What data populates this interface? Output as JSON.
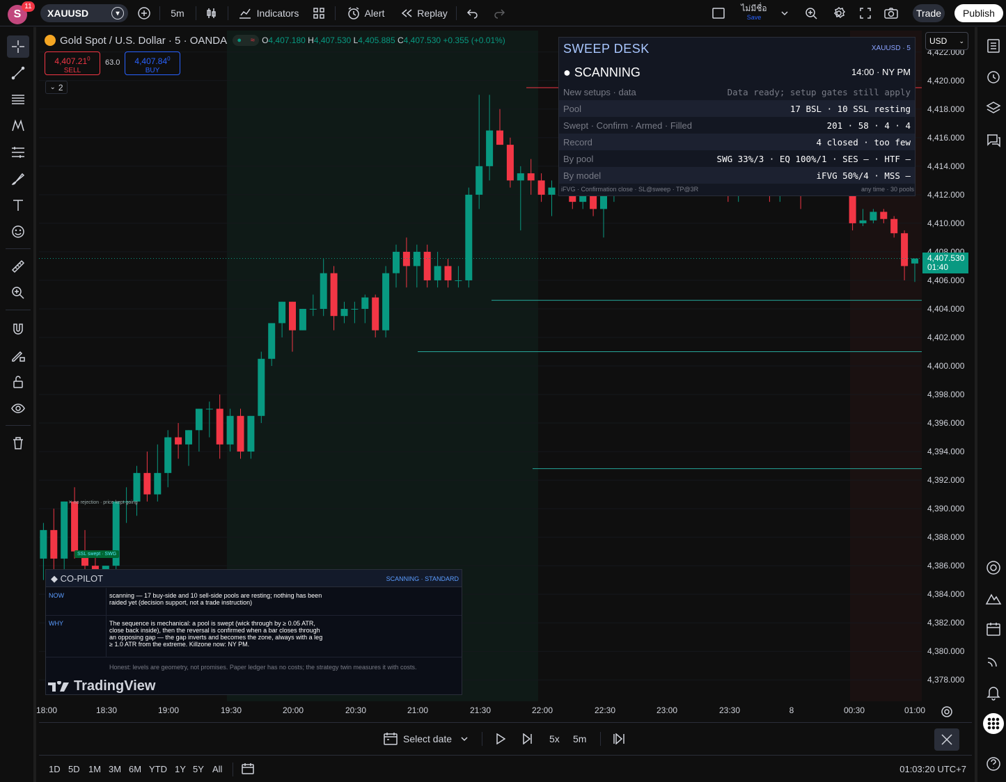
{
  "topbar": {
    "avatar_letter": "S",
    "notifications": "11",
    "symbol": "XAUUSD",
    "interval": "5m",
    "indicators_label": "Indicators",
    "alert_label": "Alert",
    "replay_label": "Replay",
    "layout_name": "ไม่มีชื่อ",
    "layout_save": "Save",
    "trade_label": "Trade",
    "publish_label": "Publish"
  },
  "legend": {
    "title": "Gold Spot / U.S. Dollar · 5 · OANDA",
    "o_key": "O",
    "o_val": "4,407.180",
    "h_key": "H",
    "h_val": "4,407.530",
    "l_key": "L",
    "l_val": "4,405.885",
    "c_key": "C",
    "c_val": "4,407.530",
    "change": "+0.355 (+0.01%)",
    "sell_price": "4,407.21",
    "sell_price_small": "0",
    "sell_label": "SELL",
    "spread": "63.0",
    "buy_price": "4,407.84",
    "buy_price_small": "0",
    "buy_label": "BUY",
    "collapsed_count": "2"
  },
  "currency": "USD",
  "price_axis": {
    "ticks": [
      "4,422.000",
      "4,420.000",
      "4,418.000",
      "4,416.000",
      "4,414.000",
      "4,412.000",
      "4,410.000",
      "4,408.000",
      "4,406.000",
      "4,404.000",
      "4,402.000",
      "4,400.000",
      "4,398.000",
      "4,396.000",
      "4,394.000",
      "4,392.000",
      "4,390.000",
      "4,388.000",
      "4,386.000",
      "4,384.000",
      "4,382.000",
      "4,380.000",
      "4,378.000"
    ],
    "current_price": "4,407.530",
    "countdown": "01:40"
  },
  "time_axis": [
    "18:00",
    "18:30",
    "19:00",
    "19:30",
    "20:00",
    "20:30",
    "21:00",
    "21:30",
    "22:00",
    "22:30",
    "23:00",
    "23:30",
    "8",
    "00:30",
    "01:00"
  ],
  "sweep_desk": {
    "title": "SWEEP DESK",
    "tag": "XAUUSD · 5",
    "state": "● SCANNING",
    "time": "14:00 · NY PM",
    "rows": [
      {
        "label": "New setups · data",
        "value": "Data ready; setup gates still apply"
      },
      {
        "label": "Pool",
        "value": "17 BSL · 10 SSL resting"
      },
      {
        "label": "Swept · Confirm · Armed · Filled",
        "value": "201 · 58 · 4 · 4"
      },
      {
        "label": "Record",
        "value": "4 closed · too few"
      },
      {
        "label": "By pool",
        "value": "SWG 33%/3 · EQ 100%/1 · SES — · HTF —"
      },
      {
        "label": "By model",
        "value": "iFVG 50%/4 · MSS —"
      }
    ],
    "footer_left": "iFVG · Confirmation close · SL@sweep · TP@3R",
    "footer_right": "any time · 30 pools"
  },
  "copilot": {
    "title": "◆ CO-PILOT",
    "status": "SCANNING · STANDARD",
    "now_key": "NOW",
    "now_text": "scanning — 17 buy-side and 10 sell-side pools are resting; nothing has been raided yet (decision support, not a trade instruction)",
    "why_key": "WHY",
    "why_text": "The sequence is mechanical: a pool is swept (wick through by ≥ 0.05 ATR, close back inside), then the reversal is confirmed when a bar closes through an opposing gap — the gap inverts and becomes the zone, always with a leg ≥ 1.0 ATR from the extreme. Killzone now: NY PM.",
    "honest_text": "Honest: levels are geometry, not promises. Paper ledger has no costs; the strategy twin measures it with costs.",
    "logo_text": "TradingView"
  },
  "annotations": {
    "no_rejection": "✕ no rejection · price kept going",
    "ssl_swept": "SSL swept · SWG"
  },
  "replay": {
    "select_date": "Select date",
    "speed": "5x",
    "interval": "5m"
  },
  "ranges": [
    "1D",
    "5D",
    "1M",
    "3M",
    "6M",
    "YTD",
    "1Y",
    "5Y",
    "All"
  ],
  "clock": "01:03:20 UTC+7",
  "colors": {
    "up": "#089981",
    "down": "#f23645",
    "accent": "#2962ff"
  },
  "chart_data": {
    "type": "candlestick",
    "symbol": "XAUUSD",
    "timeframe": "5",
    "ylim": [
      4376.5,
      4423.5
    ],
    "candles": [
      {
        "o": 4390.5,
        "h": 4392.5,
        "l": 4388.0,
        "c": 4390.0
      },
      {
        "o": 4390.0,
        "h": 4391.5,
        "l": 4388.5,
        "c": 4389.5
      },
      {
        "o": 4389.5,
        "h": 4394.5,
        "l": 4387.0,
        "c": 4392.0
      },
      {
        "o": 4392.0,
        "h": 4394.5,
        "l": 4389.5,
        "c": 4394.0
      },
      {
        "o": 4394.0,
        "h": 4395.0,
        "l": 4391.0,
        "c": 4392.5
      },
      {
        "o": 4392.5,
        "h": 4393.0,
        "l": 4389.0,
        "c": 4389.5
      },
      {
        "o": 4389.5,
        "h": 4390.0,
        "l": 4388.0,
        "c": 4389.0
      },
      {
        "o": 4389.0,
        "h": 4390.0,
        "l": 4385.5,
        "c": 4386.5
      },
      {
        "o": 4386.5,
        "h": 4389.0,
        "l": 4385.0,
        "c": 4388.5
      },
      {
        "o": 4388.5,
        "h": 4390.0,
        "l": 4383.5,
        "c": 4386.5
      },
      {
        "o": 4386.5,
        "h": 4390.5,
        "l": 4385.5,
        "c": 4390.5
      },
      {
        "o": 4390.5,
        "h": 4391.5,
        "l": 4386.5,
        "c": 4387.0
      },
      {
        "o": 4387.0,
        "h": 4388.5,
        "l": 4384.0,
        "c": 4386.0
      },
      {
        "o": 4386.0,
        "h": 4387.0,
        "l": 4382.0,
        "c": 4382.5
      },
      {
        "o": 4382.5,
        "h": 4386.0,
        "l": 4381.5,
        "c": 4386.0
      },
      {
        "o": 4386.0,
        "h": 4390.5,
        "l": 4385.5,
        "c": 4390.5
      },
      {
        "o": 4390.5,
        "h": 4391.5,
        "l": 4389.0,
        "c": 4390.5
      },
      {
        "o": 4390.5,
        "h": 4393.0,
        "l": 4389.5,
        "c": 4392.5
      },
      {
        "o": 4392.5,
        "h": 4394.0,
        "l": 4390.5,
        "c": 4391.0
      },
      {
        "o": 4391.0,
        "h": 4394.5,
        "l": 4390.5,
        "c": 4392.5
      },
      {
        "o": 4392.5,
        "h": 4395.5,
        "l": 4391.5,
        "c": 4395.0
      },
      {
        "o": 4395.0,
        "h": 4396.0,
        "l": 4393.5,
        "c": 4394.5
      },
      {
        "o": 4394.5,
        "h": 4395.5,
        "l": 4393.0,
        "c": 4395.5
      },
      {
        "o": 4395.5,
        "h": 4397.0,
        "l": 4394.0,
        "c": 4397.0
      },
      {
        "o": 4397.0,
        "h": 4397.5,
        "l": 4395.0,
        "c": 4397.0
      },
      {
        "o": 4397.0,
        "h": 4398.0,
        "l": 4393.5,
        "c": 4394.5
      },
      {
        "o": 4394.5,
        "h": 4397.0,
        "l": 4394.0,
        "c": 4396.5
      },
      {
        "o": 4396.5,
        "h": 4397.0,
        "l": 4393.5,
        "c": 4394.0
      },
      {
        "o": 4394.0,
        "h": 4396.0,
        "l": 4393.5,
        "c": 4396.5
      },
      {
        "o": 4396.5,
        "h": 4401.0,
        "l": 4396.0,
        "c": 4400.5
      },
      {
        "o": 4400.5,
        "h": 4403.0,
        "l": 4400.0,
        "c": 4403.0
      },
      {
        "o": 4403.0,
        "h": 4404.5,
        "l": 4402.0,
        "c": 4404.5
      },
      {
        "o": 4404.5,
        "h": 4404.5,
        "l": 4401.0,
        "c": 4402.5
      },
      {
        "o": 4402.5,
        "h": 4404.0,
        "l": 4402.5,
        "c": 4404.0
      },
      {
        "o": 4404.0,
        "h": 4405.0,
        "l": 4403.5,
        "c": 4404.0
      },
      {
        "o": 4404.0,
        "h": 4407.5,
        "l": 4403.5,
        "c": 4406.5
      },
      {
        "o": 4406.5,
        "h": 4407.0,
        "l": 4402.5,
        "c": 4403.5
      },
      {
        "o": 4403.5,
        "h": 4404.5,
        "l": 4403.0,
        "c": 4404.0
      },
      {
        "o": 4404.0,
        "h": 4404.5,
        "l": 4403.0,
        "c": 4404.0
      },
      {
        "o": 4404.0,
        "h": 4405.0,
        "l": 4403.0,
        "c": 4404.8
      },
      {
        "o": 4404.8,
        "h": 4405.0,
        "l": 4402.0,
        "c": 4402.5
      },
      {
        "o": 4402.5,
        "h": 4407.0,
        "l": 4402.0,
        "c": 4406.5
      },
      {
        "o": 4406.5,
        "h": 4408.5,
        "l": 4405.5,
        "c": 4408.0
      },
      {
        "o": 4408.0,
        "h": 4409.0,
        "l": 4405.5,
        "c": 4407.0
      },
      {
        "o": 4407.0,
        "h": 4408.5,
        "l": 4405.5,
        "c": 4408.0
      },
      {
        "o": 4408.0,
        "h": 4408.5,
        "l": 4405.5,
        "c": 4406.0
      },
      {
        "o": 4406.0,
        "h": 4408.0,
        "l": 4405.5,
        "c": 4407.0
      },
      {
        "o": 4407.0,
        "h": 4407.5,
        "l": 4405.5,
        "c": 4406.0
      },
      {
        "o": 4406.0,
        "h": 4407.0,
        "l": 4405.5,
        "c": 4406.0
      },
      {
        "o": 4406.0,
        "h": 4412.5,
        "l": 4405.5,
        "c": 4412.0
      },
      {
        "o": 4412.0,
        "h": 4419.0,
        "l": 4411.0,
        "c": 4414.0
      },
      {
        "o": 4414.0,
        "h": 4419.0,
        "l": 4413.0,
        "c": 4416.5
      },
      {
        "o": 4416.5,
        "h": 4418.0,
        "l": 4415.5,
        "c": 4415.5
      },
      {
        "o": 4415.5,
        "h": 4416.0,
        "l": 4412.5,
        "c": 4413.0
      },
      {
        "o": 4413.0,
        "h": 4414.0,
        "l": 4409.5,
        "c": 4413.5
      },
      {
        "o": 4413.5,
        "h": 4414.5,
        "l": 4412.0,
        "c": 4413.0
      },
      {
        "o": 4413.0,
        "h": 4413.5,
        "l": 4411.5,
        "c": 4412.0
      },
      {
        "o": 4412.0,
        "h": 4413.0,
        "l": 4410.5,
        "c": 4412.5
      },
      {
        "o": 4412.5,
        "h": 4413.5,
        "l": 4412.0,
        "c": 4413.0
      },
      {
        "o": 4413.0,
        "h": 4413.5,
        "l": 4411.0,
        "c": 4411.5
      },
      {
        "o": 4411.5,
        "h": 4413.5,
        "l": 4411.0,
        "c": 4413.0
      },
      {
        "o": 4413.0,
        "h": 4413.5,
        "l": 4410.5,
        "c": 4411.0
      },
      {
        "o": 4411.0,
        "h": 4412.5,
        "l": 4409.0,
        "c": 4412.0
      },
      {
        "o": 4412.0,
        "h": 4413.0,
        "l": 4411.5,
        "c": 4412.3
      },
      {
        "o": 4412.3,
        "h": 4413.0,
        "l": 4412.0,
        "c": 4412.8
      },
      {
        "o": 4412.8,
        "h": 4413.5,
        "l": 4412.3,
        "c": 4413.0
      },
      {
        "o": 4413.0,
        "h": 4413.5,
        "l": 4412.0,
        "c": 4412.6
      },
      {
        "o": 4412.6,
        "h": 4413.5,
        "l": 4412.0,
        "c": 4412.5
      },
      {
        "o": 4412.5,
        "h": 4413.0,
        "l": 4412.0,
        "c": 4412.4
      },
      {
        "o": 4412.4,
        "h": 4413.0,
        "l": 4412.0,
        "c": 4412.7
      },
      {
        "o": 4412.7,
        "h": 4413.0,
        "l": 4412.0,
        "c": 4412.3
      },
      {
        "o": 4412.3,
        "h": 4413.0,
        "l": 4412.0,
        "c": 4412.6
      },
      {
        "o": 4412.6,
        "h": 4413.0,
        "l": 4412.0,
        "c": 4412.5
      },
      {
        "o": 4412.5,
        "h": 4413.0,
        "l": 4412.0,
        "c": 4413.0
      },
      {
        "o": 4413.0,
        "h": 4413.5,
        "l": 4411.5,
        "c": 4412.0
      },
      {
        "o": 4412.0,
        "h": 4413.0,
        "l": 4411.5,
        "c": 4412.5
      },
      {
        "o": 4412.5,
        "h": 4413.0,
        "l": 4412.0,
        "c": 4412.6
      },
      {
        "o": 4412.6,
        "h": 4413.0,
        "l": 4412.0,
        "c": 4412.3
      },
      {
        "o": 4412.3,
        "h": 4413.0,
        "l": 4411.5,
        "c": 4412.0
      },
      {
        "o": 4412.0,
        "h": 4413.5,
        "l": 4411.5,
        "c": 4412.5
      },
      {
        "o": 4412.5,
        "h": 4413.0,
        "l": 4412.0,
        "c": 4412.8
      },
      {
        "o": 4412.8,
        "h": 4413.5,
        "l": 4411.0,
        "c": 4412.0
      },
      {
        "o": 4412.0,
        "h": 4413.0,
        "l": 4412.0,
        "c": 4412.6
      },
      {
        "o": 4412.6,
        "h": 4413.0,
        "l": 4412.2,
        "c": 4412.2
      },
      {
        "o": 4412.2,
        "h": 4413.0,
        "l": 4412.0,
        "c": 4412.7
      },
      {
        "o": 4412.7,
        "h": 4413.0,
        "l": 4412.0,
        "c": 4412.0
      },
      {
        "o": 4412.0,
        "h": 4412.5,
        "l": 4409.5,
        "c": 4410.0
      },
      {
        "o": 4410.0,
        "h": 4411.0,
        "l": 4409.8,
        "c": 4410.2
      },
      {
        "o": 4410.2,
        "h": 4411.0,
        "l": 4410.0,
        "c": 4410.8
      },
      {
        "o": 4410.8,
        "h": 4411.0,
        "l": 4410.0,
        "c": 4410.3
      },
      {
        "o": 4410.3,
        "h": 4410.5,
        "l": 4409.0,
        "c": 4409.3
      },
      {
        "o": 4409.3,
        "h": 4409.5,
        "l": 4406.0,
        "c": 4407.0
      },
      {
        "o": 4407.18,
        "h": 4407.53,
        "l": 4405.885,
        "c": 4407.53
      }
    ],
    "horizontal_levels": [
      {
        "price": 4419.5,
        "color": "#f23645"
      },
      {
        "price": 4404.6,
        "color": "#26a69a"
      },
      {
        "price": 4401.0,
        "color": "#26a69a"
      },
      {
        "price": 4392.8,
        "color": "#26a69a"
      }
    ]
  }
}
